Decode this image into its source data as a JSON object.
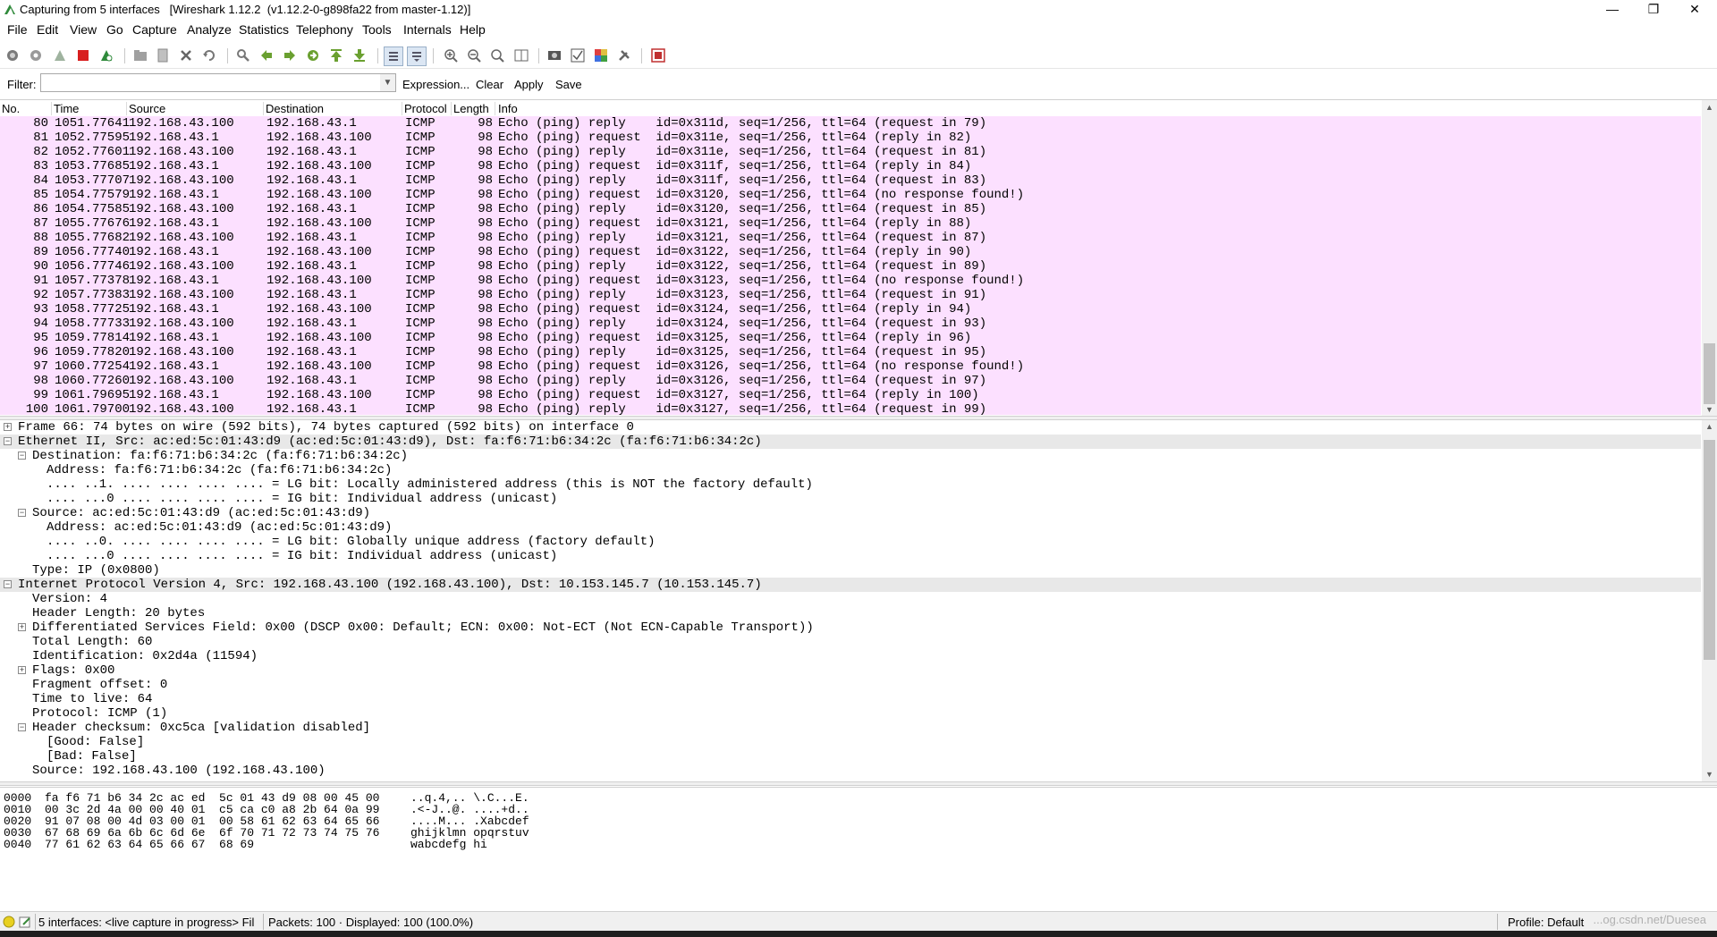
{
  "window": {
    "title": "Capturing from 5 interfaces   [Wireshark 1.12.2  (v1.12.2-0-g898fa22 from master-1.12)]",
    "minimize": "—",
    "maximize": "❐",
    "close": "✕"
  },
  "menu": [
    "File",
    "Edit",
    "View",
    "Go",
    "Capture",
    "Analyze",
    "Statistics",
    "Telephony",
    "Tools",
    "Internals",
    "Help"
  ],
  "toolbar": {
    "icons": [
      "interfaces-icon",
      "options-icon",
      "start-capture-icon",
      "stop-capture-icon",
      "restart-capture-icon",
      "open-file-icon",
      "save-file-icon",
      "close-file-icon",
      "reload-icon",
      "find-packet-icon",
      "go-back-icon",
      "go-forward-icon",
      "go-to-packet-icon",
      "go-first-icon",
      "go-last-icon",
      "colorize-icon",
      "auto-scroll-icon",
      "zoom-in-icon",
      "zoom-out-icon",
      "normal-size-icon",
      "resize-columns-icon",
      "capture-filters-icon",
      "display-filters-icon",
      "coloring-rules-icon",
      "preferences-icon",
      "help-icon"
    ]
  },
  "filter": {
    "label": "Filter:",
    "value": "",
    "expression": "Expression...",
    "clear": "Clear",
    "apply": "Apply",
    "save": "Save"
  },
  "packet_list": {
    "columns": [
      "No.",
      "Time",
      "Source",
      "Destination",
      "Protocol",
      "Length",
      "Info"
    ],
    "row_color": "#fce0ff",
    "rows": [
      {
        "no": "80",
        "time": "1051.77641",
        "src": "192.168.43.100",
        "dst": "192.168.43.1",
        "proto": "ICMP",
        "len": "98",
        "info": "Echo (ping) reply    id=0x311d, seq=1/256, ttl=64 (request in 79)"
      },
      {
        "no": "81",
        "time": "1052.77595",
        "src": "192.168.43.1",
        "dst": "192.168.43.100",
        "proto": "ICMP",
        "len": "98",
        "info": "Echo (ping) request  id=0x311e, seq=1/256, ttl=64 (reply in 82)"
      },
      {
        "no": "82",
        "time": "1052.77601",
        "src": "192.168.43.100",
        "dst": "192.168.43.1",
        "proto": "ICMP",
        "len": "98",
        "info": "Echo (ping) reply    id=0x311e, seq=1/256, ttl=64 (request in 81)"
      },
      {
        "no": "83",
        "time": "1053.77685",
        "src": "192.168.43.1",
        "dst": "192.168.43.100",
        "proto": "ICMP",
        "len": "98",
        "info": "Echo (ping) request  id=0x311f, seq=1/256, ttl=64 (reply in 84)"
      },
      {
        "no": "84",
        "time": "1053.77707",
        "src": "192.168.43.100",
        "dst": "192.168.43.1",
        "proto": "ICMP",
        "len": "98",
        "info": "Echo (ping) reply    id=0x311f, seq=1/256, ttl=64 (request in 83)"
      },
      {
        "no": "85",
        "time": "1054.77579",
        "src": "192.168.43.1",
        "dst": "192.168.43.100",
        "proto": "ICMP",
        "len": "98",
        "info": "Echo (ping) request  id=0x3120, seq=1/256, ttl=64 (no response found!)"
      },
      {
        "no": "86",
        "time": "1054.77585",
        "src": "192.168.43.100",
        "dst": "192.168.43.1",
        "proto": "ICMP",
        "len": "98",
        "info": "Echo (ping) reply    id=0x3120, seq=1/256, ttl=64 (request in 85)"
      },
      {
        "no": "87",
        "time": "1055.77676",
        "src": "192.168.43.1",
        "dst": "192.168.43.100",
        "proto": "ICMP",
        "len": "98",
        "info": "Echo (ping) request  id=0x3121, seq=1/256, ttl=64 (reply in 88)"
      },
      {
        "no": "88",
        "time": "1055.77682",
        "src": "192.168.43.100",
        "dst": "192.168.43.1",
        "proto": "ICMP",
        "len": "98",
        "info": "Echo (ping) reply    id=0x3121, seq=1/256, ttl=64 (request in 87)"
      },
      {
        "no": "89",
        "time": "1056.77740",
        "src": "192.168.43.1",
        "dst": "192.168.43.100",
        "proto": "ICMP",
        "len": "98",
        "info": "Echo (ping) request  id=0x3122, seq=1/256, ttl=64 (reply in 90)"
      },
      {
        "no": "90",
        "time": "1056.77746",
        "src": "192.168.43.100",
        "dst": "192.168.43.1",
        "proto": "ICMP",
        "len": "98",
        "info": "Echo (ping) reply    id=0x3122, seq=1/256, ttl=64 (request in 89)"
      },
      {
        "no": "91",
        "time": "1057.77378",
        "src": "192.168.43.1",
        "dst": "192.168.43.100",
        "proto": "ICMP",
        "len": "98",
        "info": "Echo (ping) request  id=0x3123, seq=1/256, ttl=64 (no response found!)"
      },
      {
        "no": "92",
        "time": "1057.77383",
        "src": "192.168.43.100",
        "dst": "192.168.43.1",
        "proto": "ICMP",
        "len": "98",
        "info": "Echo (ping) reply    id=0x3123, seq=1/256, ttl=64 (request in 91)"
      },
      {
        "no": "93",
        "time": "1058.77725",
        "src": "192.168.43.1",
        "dst": "192.168.43.100",
        "proto": "ICMP",
        "len": "98",
        "info": "Echo (ping) request  id=0x3124, seq=1/256, ttl=64 (reply in 94)"
      },
      {
        "no": "94",
        "time": "1058.77733",
        "src": "192.168.43.100",
        "dst": "192.168.43.1",
        "proto": "ICMP",
        "len": "98",
        "info": "Echo (ping) reply    id=0x3124, seq=1/256, ttl=64 (request in 93)"
      },
      {
        "no": "95",
        "time": "1059.77814",
        "src": "192.168.43.1",
        "dst": "192.168.43.100",
        "proto": "ICMP",
        "len": "98",
        "info": "Echo (ping) request  id=0x3125, seq=1/256, ttl=64 (reply in 96)"
      },
      {
        "no": "96",
        "time": "1059.77820",
        "src": "192.168.43.100",
        "dst": "192.168.43.1",
        "proto": "ICMP",
        "len": "98",
        "info": "Echo (ping) reply    id=0x3125, seq=1/256, ttl=64 (request in 95)"
      },
      {
        "no": "97",
        "time": "1060.77254",
        "src": "192.168.43.1",
        "dst": "192.168.43.100",
        "proto": "ICMP",
        "len": "98",
        "info": "Echo (ping) request  id=0x3126, seq=1/256, ttl=64 (no response found!)"
      },
      {
        "no": "98",
        "time": "1060.77260",
        "src": "192.168.43.100",
        "dst": "192.168.43.1",
        "proto": "ICMP",
        "len": "98",
        "info": "Echo (ping) reply    id=0x3126, seq=1/256, ttl=64 (request in 97)"
      },
      {
        "no": "99",
        "time": "1061.79695",
        "src": "192.168.43.1",
        "dst": "192.168.43.100",
        "proto": "ICMP",
        "len": "98",
        "info": "Echo (ping) request  id=0x3127, seq=1/256, ttl=64 (reply in 100)"
      },
      {
        "no": "100",
        "time": "1061.79700",
        "src": "192.168.43.100",
        "dst": "192.168.43.1",
        "proto": "ICMP",
        "len": "98",
        "info": "Echo (ping) reply    id=0x3127, seq=1/256, ttl=64 (request in 99)"
      }
    ]
  },
  "details": [
    {
      "level": 0,
      "toggle": "+",
      "text": "Frame 66: 74 bytes on wire (592 bits), 74 bytes captured (592 bits) on interface 0"
    },
    {
      "level": 0,
      "toggle": "-",
      "selected": true,
      "text": "Ethernet II, Src: ac:ed:5c:01:43:d9 (ac:ed:5c:01:43:d9), Dst: fa:f6:71:b6:34:2c (fa:f6:71:b6:34:2c)"
    },
    {
      "level": 1,
      "toggle": "-",
      "text": "Destination: fa:f6:71:b6:34:2c (fa:f6:71:b6:34:2c)"
    },
    {
      "level": 2,
      "toggle": "",
      "text": "Address: fa:f6:71:b6:34:2c (fa:f6:71:b6:34:2c)"
    },
    {
      "level": 2,
      "toggle": "",
      "text": ".... ..1. .... .... .... .... = LG bit: Locally administered address (this is NOT the factory default)"
    },
    {
      "level": 2,
      "toggle": "",
      "text": ".... ...0 .... .... .... .... = IG bit: Individual address (unicast)"
    },
    {
      "level": 1,
      "toggle": "-",
      "text": "Source: ac:ed:5c:01:43:d9 (ac:ed:5c:01:43:d9)"
    },
    {
      "level": 2,
      "toggle": "",
      "text": "Address: ac:ed:5c:01:43:d9 (ac:ed:5c:01:43:d9)"
    },
    {
      "level": 2,
      "toggle": "",
      "text": ".... ..0. .... .... .... .... = LG bit: Globally unique address (factory default)"
    },
    {
      "level": 2,
      "toggle": "",
      "text": ".... ...0 .... .... .... .... = IG bit: Individual address (unicast)"
    },
    {
      "level": 1,
      "toggle": "",
      "text": "Type: IP (0x0800)"
    },
    {
      "level": 0,
      "toggle": "-",
      "selected": true,
      "text": "Internet Protocol Version 4, Src: 192.168.43.100 (192.168.43.100), Dst: 10.153.145.7 (10.153.145.7)"
    },
    {
      "level": 1,
      "toggle": "",
      "text": "Version: 4"
    },
    {
      "level": 1,
      "toggle": "",
      "text": "Header Length: 20 bytes"
    },
    {
      "level": 1,
      "toggle": "+",
      "text": "Differentiated Services Field: 0x00 (DSCP 0x00: Default; ECN: 0x00: Not-ECT (Not ECN-Capable Transport))"
    },
    {
      "level": 1,
      "toggle": "",
      "text": "Total Length: 60"
    },
    {
      "level": 1,
      "toggle": "",
      "text": "Identification: 0x2d4a (11594)"
    },
    {
      "level": 1,
      "toggle": "+",
      "text": "Flags: 0x00"
    },
    {
      "level": 1,
      "toggle": "",
      "text": "Fragment offset: 0"
    },
    {
      "level": 1,
      "toggle": "",
      "text": "Time to live: 64"
    },
    {
      "level": 1,
      "toggle": "",
      "text": "Protocol: ICMP (1)"
    },
    {
      "level": 1,
      "toggle": "-",
      "text": "Header checksum: 0xc5ca [validation disabled]"
    },
    {
      "level": 2,
      "toggle": "",
      "text": "[Good: False]"
    },
    {
      "level": 2,
      "toggle": "",
      "text": "[Bad: False]"
    },
    {
      "level": 1,
      "toggle": "",
      "text": "Source: 192.168.43.100 (192.168.43.100)"
    }
  ],
  "bytes": [
    {
      "offset": "0000",
      "hex": "fa f6 71 b6 34 2c ac ed  5c 01 43 d9 08 00 45 00",
      "ascii": "..q.4,.. \\.C...E."
    },
    {
      "offset": "0010",
      "hex": "00 3c 2d 4a 00 00 40 01  c5 ca c0 a8 2b 64 0a 99",
      "ascii": ".<-J..@. ....+d.."
    },
    {
      "offset": "0020",
      "hex": "91 07 08 00 4d 03 00 01  00 58 61 62 63 64 65 66",
      "ascii": "....M... .Xabcdef"
    },
    {
      "offset": "0030",
      "hex": "67 68 69 6a 6b 6c 6d 6e  6f 70 71 72 73 74 75 76",
      "ascii": "ghijklmn opqrstuv"
    },
    {
      "offset": "0040",
      "hex": "77 61 62 63 64 65 66 67  68 69",
      "ascii": "wabcdefg hi"
    }
  ],
  "status": {
    "interfaces": "5 interfaces: <live capture in progress> Fil",
    "packets": "Packets: 100 · Displayed: 100 (100.0%)",
    "profile": "Profile: Default",
    "watermark": "...og.csdn.net/Duesea"
  },
  "colors": {
    "packet_row": "#fce0ff",
    "selected_detail": "#e8e8e8",
    "stop_button": "#d81e1e",
    "shark_fin": "#2f8a3b"
  }
}
